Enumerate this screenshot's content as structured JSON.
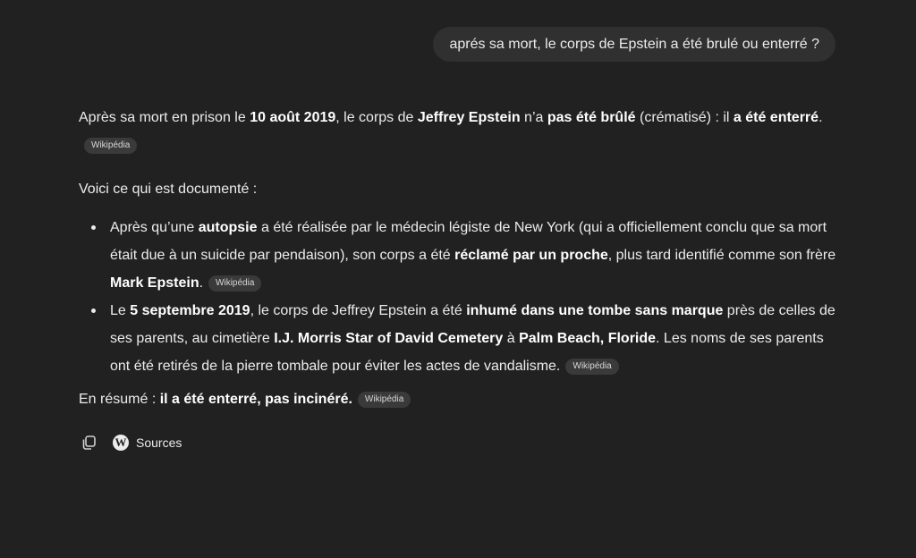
{
  "user_message": "aprés sa mort, le corps de Epstein a été brulé ou enterré ?",
  "answer": {
    "p1": {
      "t1": "Après sa mort en prison le ",
      "b1": "10 août 2019",
      "t2": ", le corps de ",
      "b2": "Jeffrey Epstein",
      "t3": " n’a ",
      "b3": "pas été brûlé",
      "t4": " (crématisé) : il ",
      "b4": "a été enterré",
      "t5": "."
    },
    "p2": "Voici ce qui est documenté :",
    "bullet1": {
      "t1": "Après qu’une ",
      "b1": "autopsie",
      "t2": " a été réalisée par le médecin légiste de New York (qui a officiellement conclu que sa mort était due à un suicide par pendaison), son corps a été ",
      "b2": "réclamé par un proche",
      "t3": ", plus tard identifié comme son frère ",
      "b3": "Mark Epstein",
      "t4": "."
    },
    "bullet2": {
      "t1": "Le ",
      "b1": "5 septembre 2019",
      "t2": ", le corps de Jeffrey Epstein a été ",
      "b2": "inhumé dans une tombe sans marque",
      "t3": " près de celles de ses parents, au cimetière ",
      "b3": "I.J. Morris Star of David Cemetery",
      "t4": " à ",
      "b4": "Palm Beach, Floride",
      "t5": ". Les noms de ses parents ont été retirés de la pierre tombale pour éviter les actes de vandalisme."
    },
    "summary": {
      "t1": "En résumé : ",
      "b1": "il a été enterré, pas incinéré."
    },
    "source_chip": "Wikipédia"
  },
  "actions": {
    "sources_label": "Sources",
    "icons": [
      "copy-icon",
      "wikipedia-icon"
    ]
  },
  "colors": {
    "background": "#212121",
    "bubble": "#303030",
    "chip": "#3a3a3a",
    "text": "#ececec"
  }
}
